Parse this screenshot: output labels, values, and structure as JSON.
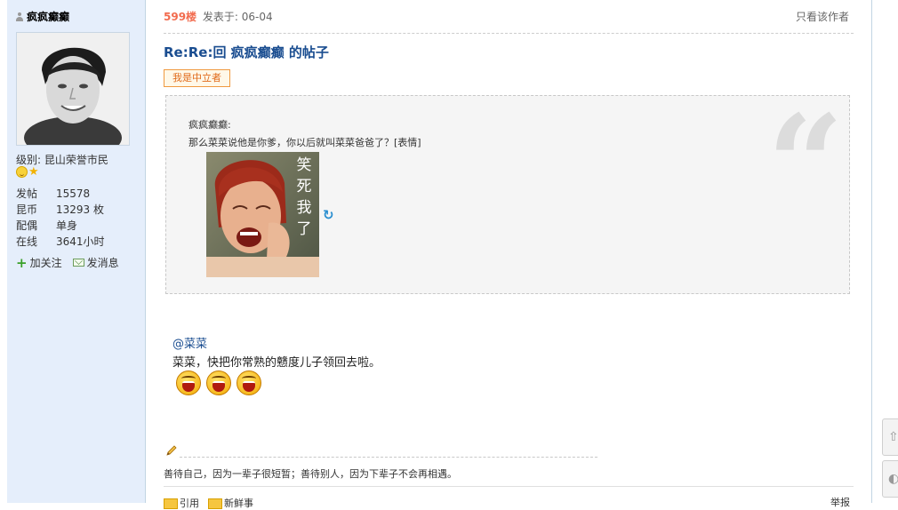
{
  "user": {
    "name": "疯疯癫癫",
    "level": "级别: 昆山荣誉市民",
    "stats": [
      {
        "label": "发帖",
        "value": "15578"
      },
      {
        "label": "昆币",
        "value": "13293 枚"
      },
      {
        "label": "配偶",
        "value": "单身"
      },
      {
        "label": "在线",
        "value": "3641小时"
      }
    ],
    "follow_label": "加关注",
    "message_label": "发消息"
  },
  "post": {
    "floor": "599楼",
    "posted_at": "发表于: 06-04",
    "only_author": "只看该作者",
    "title": "Re:Re:回 疯疯癫癫 的帖子",
    "badge": "我是中立者",
    "quote": {
      "author": "疯疯癫癫:",
      "text": "那么菜菜说他是你爹，你以后就叫菜菜爸爸了？[表情]",
      "image_caption": "笑死我了"
    },
    "mention": "@菜菜",
    "reply_text": "菜菜，快把你常熟的戆度儿子领回去啦。",
    "signature": "善待自己，因为一辈子很短暂；善待别人，因为下辈子不会再相遇。",
    "footer": {
      "quote_label": "引用",
      "new_label": "新鲜事",
      "report_label": "举报"
    }
  },
  "colors": {
    "sidebar_bg": "#e5eefb",
    "title": "#1a4d90",
    "floor": "#f26c4f",
    "badge_border": "#f09a40"
  }
}
